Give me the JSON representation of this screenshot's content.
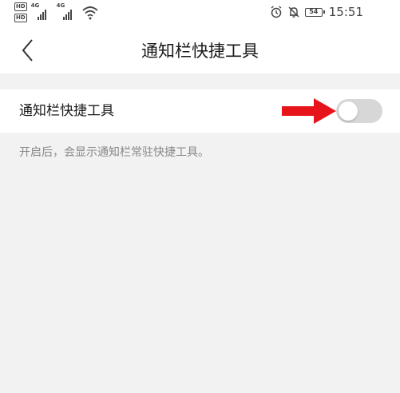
{
  "status_bar": {
    "hd1": "HD",
    "hd2": "HD",
    "sim1_network": "4G",
    "sim2_network": "4G",
    "battery_level": "54",
    "time": "15:51",
    "icons": [
      "signal-icon",
      "wifi-icon",
      "alarm-icon",
      "mute-icon",
      "battery-icon"
    ]
  },
  "header": {
    "title": "通知栏快捷工具",
    "back_icon": "chevron-left-icon"
  },
  "setting": {
    "label": "通知栏快捷工具",
    "toggle_on": false,
    "description": "开启后，会显示通知栏常驻快捷工具。"
  },
  "annotation": {
    "icon": "red-arrow-icon",
    "color": "#e8141c"
  },
  "colors": {
    "background": "#f2f2f2",
    "surface": "#ffffff",
    "toggle_off": "#d7d7d7",
    "text_primary": "#1a1a1a",
    "text_secondary": "#888888"
  }
}
